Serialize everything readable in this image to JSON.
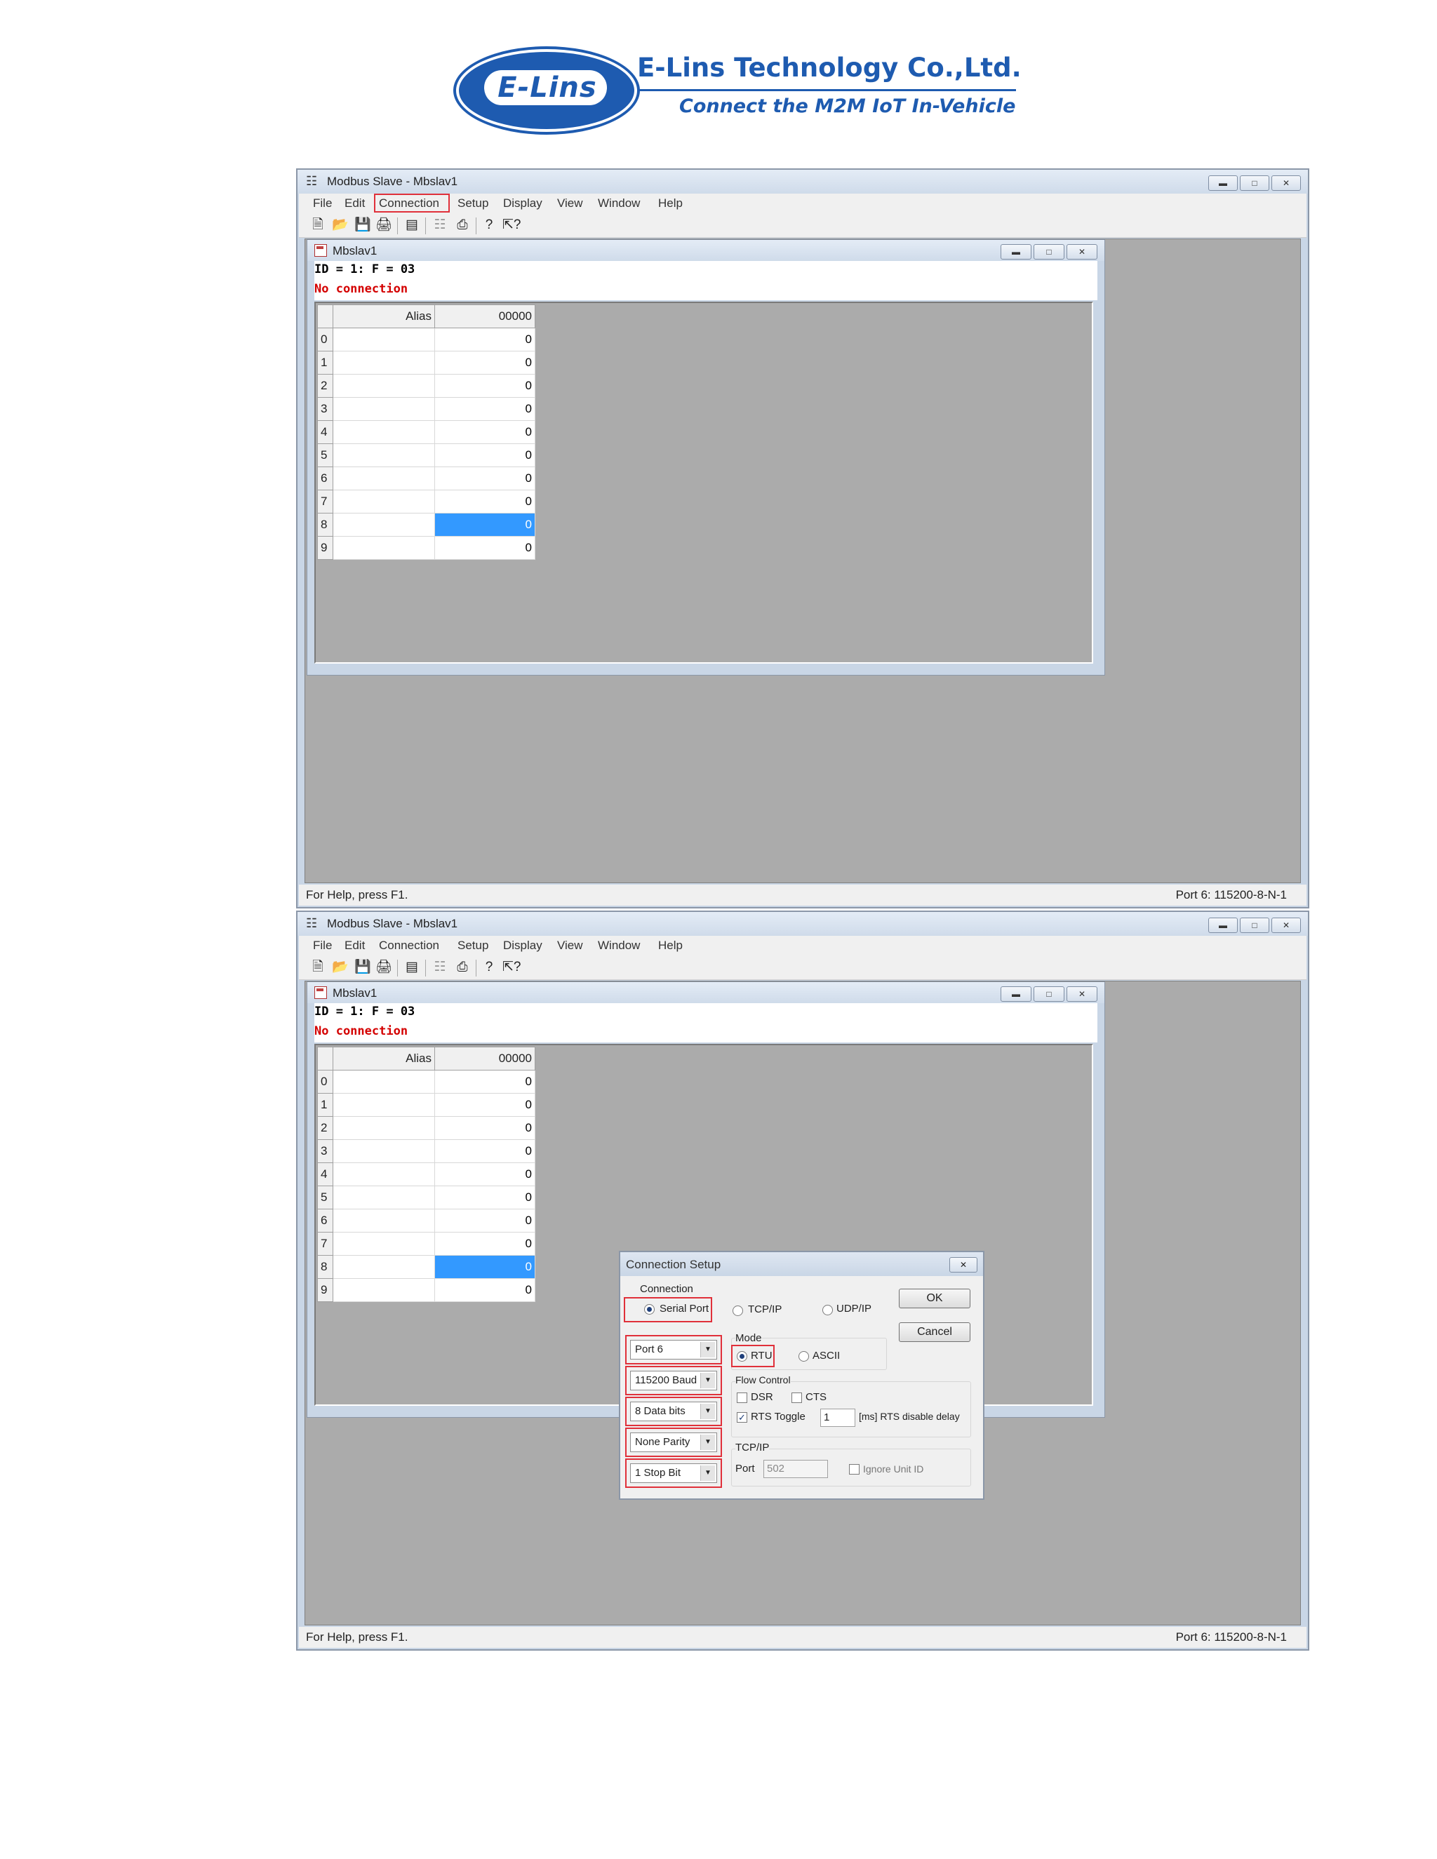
{
  "logo": {
    "mark": "E-Lins",
    "company": "E-Lins Technology Co.,Ltd.",
    "tagline": "Connect the M2M IoT In-Vehicle"
  },
  "app": {
    "title": "Modbus Slave - Mbslav1",
    "menu": [
      "File",
      "Edit",
      "Connection",
      "Setup",
      "Display",
      "View",
      "Window",
      "Help"
    ],
    "status_left": "For Help, press F1.",
    "status_right": "Port 6: 115200-8-N-1"
  },
  "child": {
    "title": "Mbslav1",
    "id_line": "ID = 1: F = 03",
    "connection_status": "No connection",
    "grid": {
      "col_alias": "Alias",
      "col_value": "00000",
      "rows": [
        {
          "index": "0",
          "value": "0"
        },
        {
          "index": "1",
          "value": "0"
        },
        {
          "index": "2",
          "value": "0"
        },
        {
          "index": "3",
          "value": "0"
        },
        {
          "index": "4",
          "value": "0"
        },
        {
          "index": "5",
          "value": "0"
        },
        {
          "index": "6",
          "value": "0"
        },
        {
          "index": "7",
          "value": "0"
        },
        {
          "index": "8",
          "value": "0"
        },
        {
          "index": "9",
          "value": "0"
        }
      ]
    }
  },
  "dialog": {
    "title": "Connection Setup",
    "connection_group": "Connection",
    "serial_port": "Serial Port",
    "tcpip": "TCP/IP",
    "udpip": "UDP/IP",
    "ok": "OK",
    "cancel": "Cancel",
    "port": "Port 6",
    "baud": "115200 Baud",
    "data_bits": "8 Data bits",
    "parity": "None Parity",
    "stop_bit": "1 Stop Bit",
    "mode_group": "Mode",
    "rtu": "RTU",
    "ascii": "ASCII",
    "flow_group": "Flow Control",
    "dsr": "DSR",
    "cts": "CTS",
    "rts_toggle": "RTS Toggle",
    "rts_delay_value": "1",
    "rts_delay_label": "[ms] RTS disable delay",
    "tcpip_group": "TCP/IP",
    "port_label": "Port",
    "port_value": "502",
    "ignore_unit_id": "Ignore Unit ID"
  },
  "colors": {
    "highlight_box": "#e0303a",
    "selected_cell": "#3399ff",
    "no_connection": "#d40000",
    "logo_blue": "#1e5bb0"
  }
}
